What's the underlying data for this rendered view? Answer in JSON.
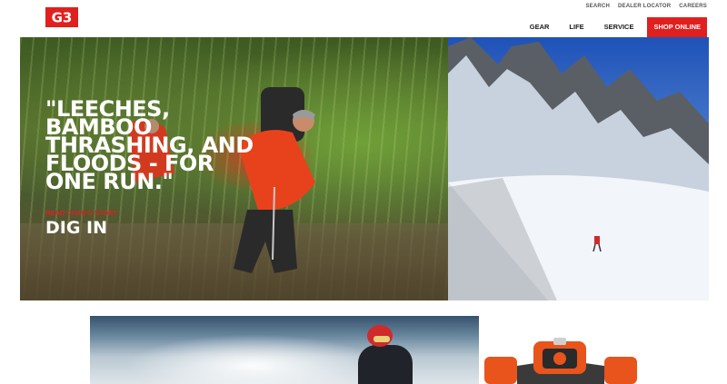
{
  "header": {
    "logo_text": "G3",
    "utility_nav": [
      "SEARCH",
      "DEALER LOCATOR",
      "CAREERS"
    ],
    "main_nav": [
      "GEAR",
      "LIFE",
      "SERVICE"
    ],
    "shop_button": "SHOP ONLINE"
  },
  "hero": {
    "quote": "\"LEECHES, BAMBOO THRASHING, AND FLOODS - FOR ONE RUN.\"",
    "story_link": "READ CHAD'S STORY",
    "cta": "DIG IN"
  },
  "colors": {
    "accent_red": "#e0201f",
    "text_dark": "#1a1a1a",
    "text_muted": "#555555"
  }
}
